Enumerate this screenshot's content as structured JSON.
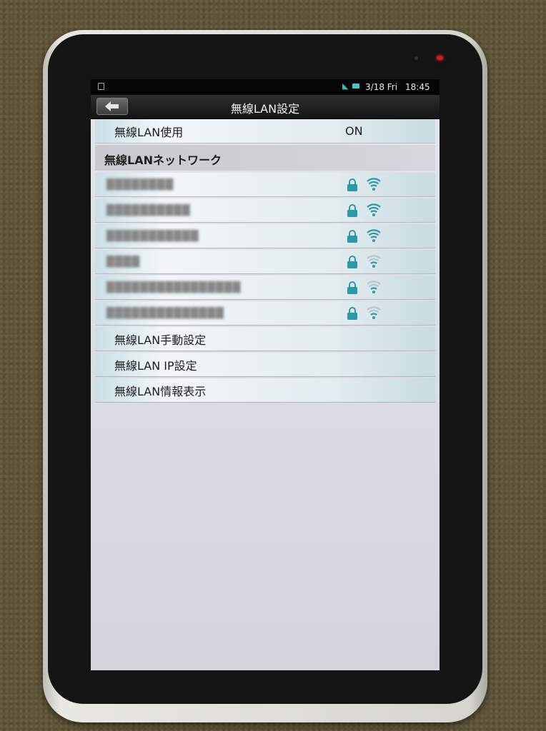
{
  "status_bar": {
    "date": "3/18 Fri",
    "time": "18:45"
  },
  "header": {
    "title": "無線LAN設定",
    "back_icon": "back-arrow-icon"
  },
  "wifi_toggle": {
    "label": "無線LAN使用",
    "value": "ON"
  },
  "networks_section": {
    "label": "無線LANネットワーク"
  },
  "networks": [
    {
      "ssid": "████████",
      "secured": true,
      "signal": 3
    },
    {
      "ssid": "██████████",
      "secured": true,
      "signal": 3
    },
    {
      "ssid": "███████████",
      "secured": true,
      "signal": 3
    },
    {
      "ssid": "████",
      "secured": true,
      "signal": 1
    },
    {
      "ssid": "████████████████",
      "secured": true,
      "signal": 1
    },
    {
      "ssid": "██████████████",
      "secured": true,
      "signal": 1
    }
  ],
  "menu": [
    {
      "label": "無線LAN手動設定"
    },
    {
      "label": "無線LAN IP設定"
    },
    {
      "label": "無線LAN情報表示"
    }
  ],
  "colors": {
    "accent": "#2a9aa8",
    "signal_weak": "#b9c6c9"
  }
}
